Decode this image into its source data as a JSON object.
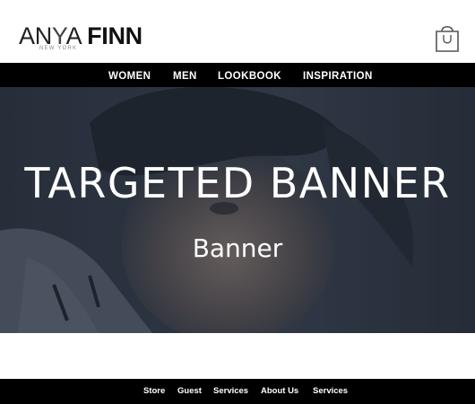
{
  "brand": {
    "name_part1": "AN",
    "name_part2": "Y",
    "name_part3": "A ",
    "name_part4": "FINN",
    "tagline": "NEW YORK"
  },
  "header": {
    "cart_icon": "shopping-bag-icon"
  },
  "nav": {
    "items": [
      "WOMEN",
      "MEN",
      "LOOKBOOK",
      "INSPIRATION"
    ]
  },
  "banner": {
    "title": "TARGETED BANNER",
    "subtitle": "Banner"
  },
  "footer": {
    "links": [
      "Store",
      "Guest",
      "Services",
      "About Us",
      "Services"
    ]
  },
  "colors": {
    "nav_background": "#000000",
    "footer_background": "#000000",
    "banner_text": "#ffffff"
  }
}
